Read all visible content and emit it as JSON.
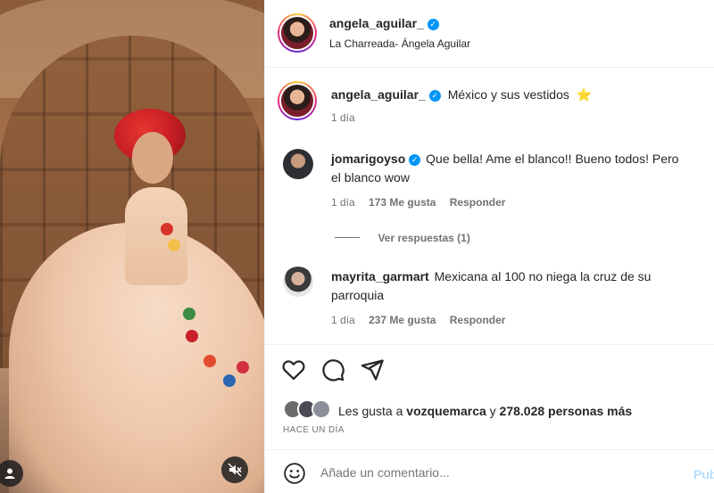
{
  "media": {
    "account_icon": "user-icon",
    "mute_icon": "speaker-muted-icon"
  },
  "header": {
    "username": "angela_aguilar_",
    "verified_icon": "verified-badge-icon",
    "audio": "La Charreada- Ángela Aguilar"
  },
  "caption": {
    "username": "angela_aguilar_",
    "text": "México y sus vestidos",
    "emoji": "⭐",
    "time": "1 día"
  },
  "comments": [
    {
      "username": "jomarigoyso",
      "verified": true,
      "text_line1": "Que bella! Ame el blanco!! Bueno todos! Pero",
      "text_line2": "el blanco wow",
      "time": "1 día",
      "likes": "173 Me gusta",
      "reply": "Responder"
    },
    {
      "username": "mayrita_garmart",
      "verified": false,
      "text_line1": "Mexicana al 100 no niega la cruz de su",
      "text_line2": "parroquia",
      "time": "1 día",
      "likes": "237 Me gusta",
      "reply": "Responder"
    }
  ],
  "view_replies": "Ver respuestas (1)",
  "actions": {
    "like_icon": "heart-icon",
    "comment_icon": "comment-bubble-icon",
    "share_icon": "paper-plane-icon"
  },
  "likes": {
    "prefix": "Les gusta a",
    "user": "vozquemarca",
    "connector": "y",
    "count": "278.028 personas más"
  },
  "timestamp": "HACE UN DÍA",
  "composer": {
    "emoji_icon": "smiley-icon",
    "placeholder": "Añade un comentario...",
    "publish": "Pub"
  },
  "colors": {
    "verified_blue": "#0095f6",
    "publish_faded": "#b2dffc",
    "secondary_text": "#737373"
  }
}
